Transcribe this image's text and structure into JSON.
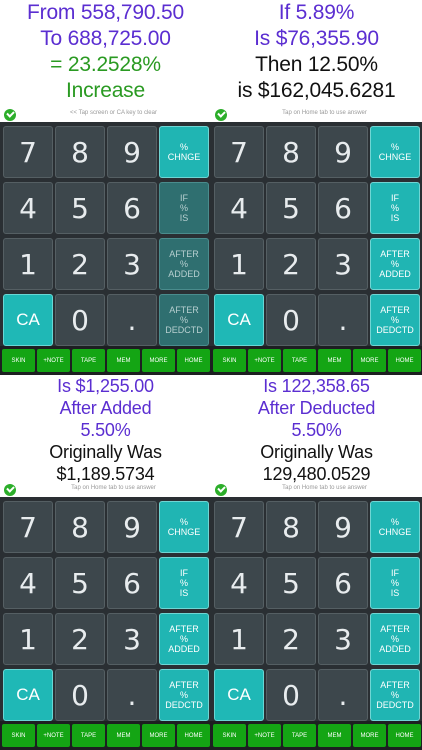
{
  "panels": [
    {
      "display": [
        {
          "text": "From 558,790.50",
          "color": "purple"
        },
        {
          "text": "To 688,725.00",
          "color": "purple"
        },
        {
          "text": "= 23.2528%",
          "color": "green"
        },
        {
          "text": "Increase",
          "color": "green"
        }
      ],
      "hint": "<< Tap screen or CA key to clear",
      "active_op": "change"
    },
    {
      "display": [
        {
          "text": "If 5.89%",
          "color": "purple"
        },
        {
          "text": "Is $76,355.90",
          "color": "purple"
        },
        {
          "text": "Then 12.50%",
          "color": "black"
        },
        {
          "text": "is $162,045.6281",
          "color": "black"
        }
      ],
      "hint": "Tap on Home tab to use answer",
      "active_op": "all"
    },
    {
      "display": [
        {
          "text": "Is $1,255.00",
          "color": "purple"
        },
        {
          "text": "After Added",
          "color": "purple"
        },
        {
          "text": "5.50%",
          "color": "purple"
        },
        {
          "text": "Originally Was",
          "color": "black"
        },
        {
          "text": "$1,189.5734",
          "color": "black"
        }
      ],
      "hint": "Tap on Home tab to use answer",
      "active_op": "all"
    },
    {
      "display": [
        {
          "text": "Is 122,358.65",
          "color": "purple"
        },
        {
          "text": "After Deducted",
          "color": "purple"
        },
        {
          "text": "5.50%",
          "color": "purple"
        },
        {
          "text": "Originally Was",
          "color": "black"
        },
        {
          "text": "129,480.0529",
          "color": "black"
        }
      ],
      "hint": "Tap on Home tab to use answer",
      "active_op": "all"
    }
  ],
  "keys": {
    "digits": [
      "7",
      "8",
      "9",
      "4",
      "5",
      "6",
      "1",
      "2",
      "3"
    ],
    "clear": "CA",
    "zero": "0",
    "decimal": ".",
    "ops": [
      [
        "%",
        "CHNGE"
      ],
      [
        "IF",
        "%",
        "IS"
      ],
      [
        "AFTER",
        "%",
        "ADDED"
      ],
      [
        "AFTER",
        "%",
        "DEDCTD"
      ]
    ]
  },
  "tabs": [
    "SKIN",
    "+NOTE",
    "TAPE",
    "MEM",
    "MORE",
    "HOME"
  ],
  "colors": {
    "purple": "#5b2ed1",
    "green": "#2a9a22",
    "teal": "#20b5b3",
    "keypad_bg": "#2a2f33",
    "tab_green": "#14a514"
  }
}
